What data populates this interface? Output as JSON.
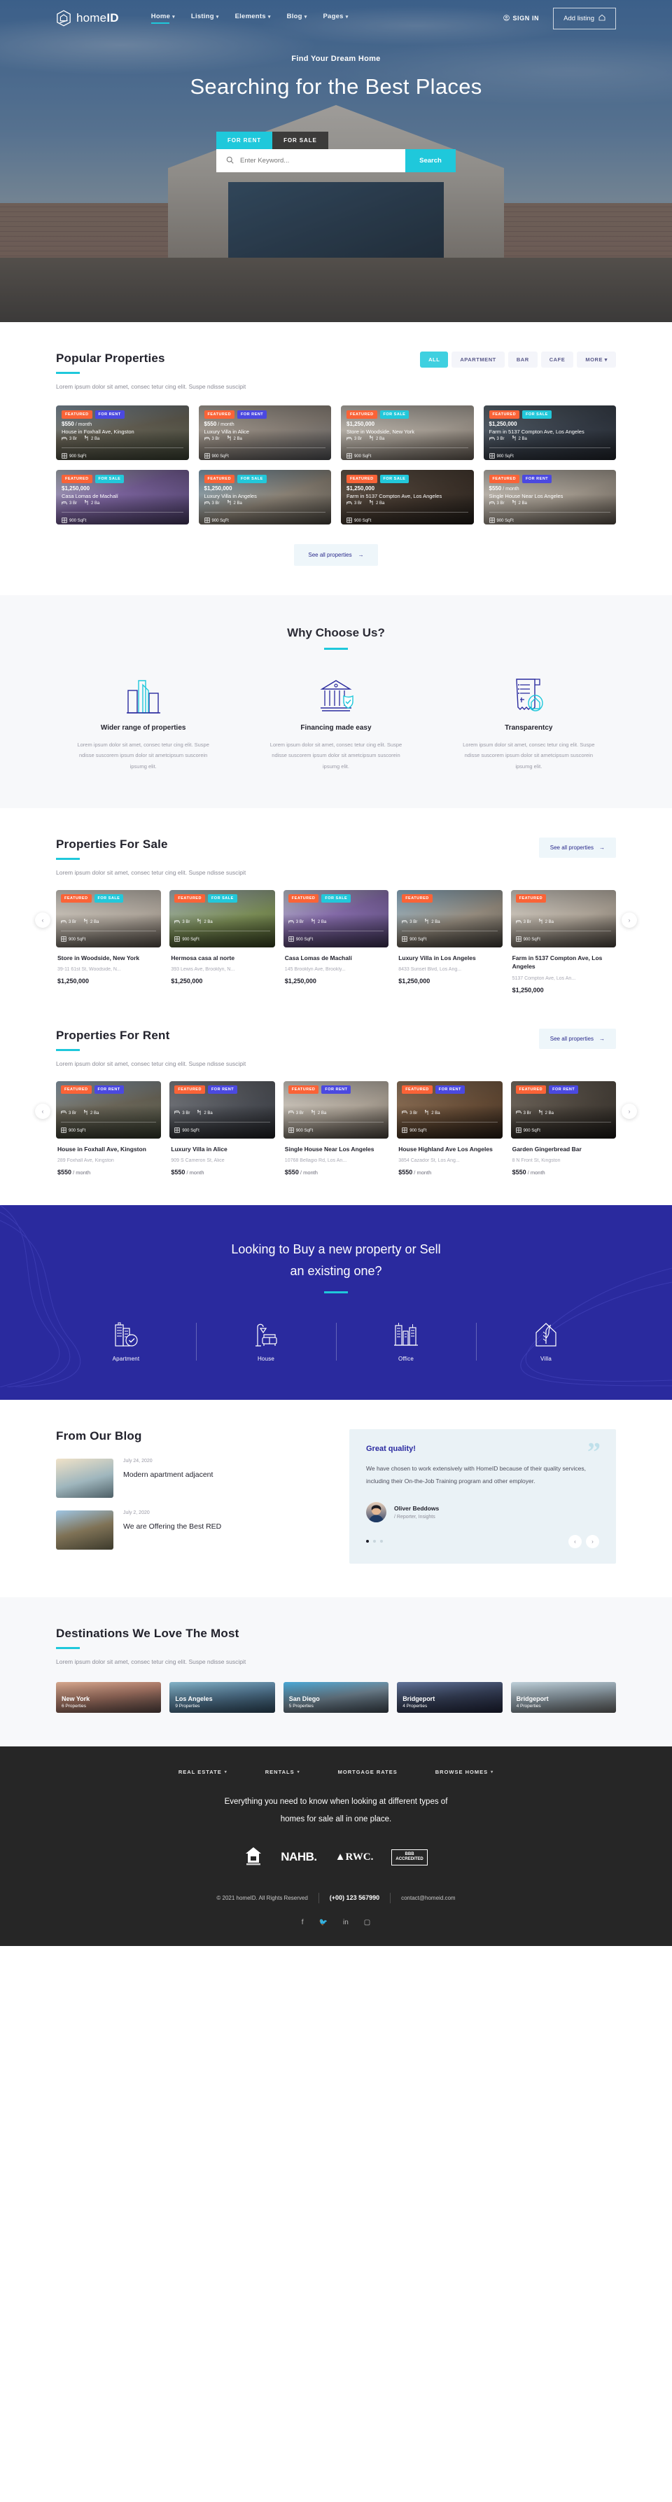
{
  "brand": {
    "name_light": "home",
    "name_bold": "ID"
  },
  "nav": {
    "links": [
      {
        "label": "Home",
        "caret": "⌄"
      },
      {
        "label": "Listing",
        "caret": "⌄"
      },
      {
        "label": "Elements",
        "caret": "⌄"
      },
      {
        "label": "Blog",
        "caret": "⌄"
      },
      {
        "label": "Pages",
        "caret": "⌄"
      }
    ],
    "signin": "SIGN IN",
    "add_listing": "Add listing"
  },
  "hero": {
    "kicker": "Find Your Dream Home",
    "title": "Searching for the Best Places",
    "tab_rent": "FOR RENT",
    "tab_sale": "FOR SALE",
    "search_placeholder": "Enter Keyword...",
    "search_button": "Search"
  },
  "popular": {
    "title": "Popular Properties",
    "subtitle": "Lorem ipsum dolor sit amet, consec tetur cing elit. Suspe ndisse suscipit",
    "filters": [
      "ALL",
      "APARTMENT",
      "BAR",
      "CAFE",
      "MORE ▾"
    ],
    "active_filter": "ALL",
    "see_all": "See all properties",
    "cards": [
      {
        "badges": [
          "FEATURED",
          "FOR RENT"
        ],
        "price": "$550",
        "per": " / month",
        "name": "House in Foxhall Ave, Kingston",
        "beds": "3 Br",
        "baths": "2 Ba",
        "area": "900 SqFt",
        "img": "house-victorian"
      },
      {
        "badges": [
          "FEATURED",
          "FOR RENT"
        ],
        "price": "$550",
        "per": " / month",
        "name": "Luxury Villa in Alice",
        "beds": "3 Br",
        "baths": "2 Ba",
        "area": "900 SqFt",
        "img": "living-room"
      },
      {
        "badges": [
          "FEATURED",
          "FOR SALE"
        ],
        "price": "$1,250,000",
        "per": "",
        "name": "Store in Woodside, New York",
        "beds": "3 Br",
        "baths": "2 Ba",
        "area": "900 SqFt",
        "img": "interior-white"
      },
      {
        "badges": [
          "FEATURED",
          "FOR SALE"
        ],
        "price": "$1,250,000",
        "per": "",
        "name": "Farm in 5137 Compton Ave, Los Angeles",
        "beds": "3 Br",
        "baths": "2 Ba",
        "area": "900 SqFt",
        "img": "modern-dark"
      },
      {
        "badges": [
          "FEATURED",
          "FOR SALE"
        ],
        "price": "$1,250,000",
        "per": "",
        "name": "Casa Lomas de Machalí",
        "beds": "3 Br",
        "baths": "2 Ba",
        "area": "900 SqFt",
        "img": "purple-stairs"
      },
      {
        "badges": [
          "FEATURED",
          "FOR SALE"
        ],
        "price": "$1,250,000",
        "per": "",
        "name": "Luxury Villa in Angeles",
        "beds": "3 Br",
        "baths": "2 Ba",
        "area": "900 SqFt",
        "img": "villa-modern"
      },
      {
        "badges": [
          "FEATURED",
          "FOR SALE"
        ],
        "price": "$1,250,000",
        "per": "",
        "name": "Farm in 5137 Compton Ave, Los Angeles",
        "beds": "3 Br",
        "baths": "2 Ba",
        "area": "900 SqFt",
        "img": "dining-dark"
      },
      {
        "badges": [
          "FEATURED",
          "FOR RENT"
        ],
        "price": "$550",
        "per": " / month",
        "name": "Single House Near Los Angeles",
        "beds": "3 Br",
        "baths": "2 Ba",
        "area": "900 SqFt",
        "img": "bright-room"
      }
    ]
  },
  "why": {
    "title": "Why Choose Us?",
    "columns": [
      {
        "icon": "buildings-icon",
        "title": "Wider range of properties",
        "text": "Lorem ipsum dolor sit amet, consec tetur cing elit. Suspe ndisse suscorem ipsum dolor sit ametcipsum suscorein ipsumg elit."
      },
      {
        "icon": "bank-shield-icon",
        "title": "Financing made easy",
        "text": "Lorem ipsum dolor sit amet, consec tetur cing elit. Suspe ndisse suscorem ipsum dolor sit ametcipsum suscorein ipsumg elit."
      },
      {
        "icon": "receipt-house-icon",
        "title": "Transparentcy",
        "text": "Lorem ipsum dolor sit amet, consec tetur cing elit. Suspe ndisse suscorem ipsum dolor sit ametcipsum suscorein ipsumg elit."
      }
    ]
  },
  "for_sale": {
    "title": "Properties For Sale",
    "subtitle": "Lorem ipsum dolor sit amet, consec tetur cing elit. Suspe ndisse suscipit",
    "see_all": "See all properties",
    "cards": [
      {
        "badges": [
          "FEATURED",
          "FOR SALE"
        ],
        "title": "Store in Woodside, New York",
        "address": "39-11 61st St, Woodside, N...",
        "price": "$1,250,000",
        "per": "",
        "beds": "3 Br",
        "baths": "2 Ba",
        "area": "900 SqFt",
        "img": "interior-white"
      },
      {
        "badges": [
          "FEATURED",
          "FOR SALE"
        ],
        "title": "Hermosa casa al norte",
        "address": "393 Lewis Ave, Brooklyn, N...",
        "price": "$1,250,000",
        "per": "",
        "beds": "3 Br",
        "baths": "2 Ba",
        "area": "900 SqFt",
        "img": "house-green"
      },
      {
        "badges": [
          "FEATURED",
          "FOR SALE"
        ],
        "title": "Casa Lomas de Machalí",
        "address": "145 Brooklyn Ave, Brookly...",
        "price": "$1,250,000",
        "per": "",
        "beds": "3 Br",
        "baths": "2 Ba",
        "area": "900 SqFt",
        "img": "purple-stairs"
      },
      {
        "badges": [
          "FEATURED"
        ],
        "title": "Luxury Villa in Los Angeles",
        "address": "8433 Sunset Blvd, Los Ang...",
        "price": "$1,250,000",
        "per": "",
        "beds": "3 Br",
        "baths": "2 Ba",
        "area": "900 SqFt",
        "img": "villa-modern"
      },
      {
        "badges": [
          "FEATURED"
        ],
        "title": "Farm in 5137 Compton Ave, Los Angeles",
        "address": "5137 Compton Ave, Los An...",
        "price": "$1,250,000",
        "per": "",
        "beds": "3 Br",
        "baths": "2 Ba",
        "area": "900 SqFt",
        "img": "bright-room"
      }
    ]
  },
  "for_rent": {
    "title": "Properties For Rent",
    "subtitle": "Lorem ipsum dolor sit amet, consec tetur cing elit. Suspe ndisse suscipit",
    "see_all": "See all properties",
    "cards": [
      {
        "badges": [
          "FEATURED",
          "FOR RENT"
        ],
        "title": "House in Foxhall Ave, Kingston",
        "address": "289 Foxhall Ave, Kingston",
        "price": "$550",
        "per": " / month",
        "beds": "3 Br",
        "baths": "2 Ba",
        "area": "900 SqFt",
        "img": "house-victorian"
      },
      {
        "badges": [
          "FEATURED",
          "FOR RENT"
        ],
        "title": "Luxury Villa in Alice",
        "address": "909 S Cameron St, Alice",
        "price": "$550",
        "per": " / month",
        "beds": "3 Br",
        "baths": "2 Ba",
        "area": "900 SqFt",
        "img": "patio-dark"
      },
      {
        "badges": [
          "FEATURED",
          "FOR RENT"
        ],
        "title": "Single House Near Los Angeles",
        "address": "10768 Bellagio Rd, Los An...",
        "price": "$550",
        "per": " / month",
        "beds": "3 Br",
        "baths": "2 Ba",
        "area": "900 SqFt",
        "img": "bright-room"
      },
      {
        "badges": [
          "FEATURED",
          "FOR RENT"
        ],
        "title": "House Highland Ave Los Angeles",
        "address": "3854 Cazador St, Los Ang...",
        "price": "$550",
        "per": " / month",
        "beds": "3 Br",
        "baths": "2 Ba",
        "area": "900 SqFt",
        "img": "kitchen-warm"
      },
      {
        "badges": [
          "FEATURED",
          "FOR RENT"
        ],
        "title": "Garden Gingerbread Bar",
        "address": "8 N Front St, Kingston",
        "price": "$550",
        "per": " / month",
        "beds": "3 Br",
        "baths": "2 Ba",
        "area": "900 SqFt",
        "img": "lounge-dark"
      }
    ]
  },
  "cta": {
    "line1": "Looking to Buy a new property or Sell",
    "line2": "an existing one?",
    "items": [
      {
        "icon": "apartment-check-icon",
        "label": "Apartment"
      },
      {
        "icon": "sofa-lamp-icon",
        "label": "House"
      },
      {
        "icon": "office-towers-icon",
        "label": "Office"
      },
      {
        "icon": "villa-leaf-icon",
        "label": "Villa"
      }
    ]
  },
  "blog": {
    "title": "From Our Blog",
    "posts": [
      {
        "date": "July 24, 2020",
        "title": "Modern apartment adjacent",
        "img": "seaside-terrace"
      },
      {
        "date": "July 2, 2020",
        "title": "We are Offering the Best RED",
        "img": "cottage-evening"
      }
    ]
  },
  "testimonial": {
    "heading": "Great quality!",
    "body": "We have chosen to work extensively with HomeID because of their quality services, including their On-the-Job Training program and other employer.",
    "name": "Oliver Beddows",
    "role": "/ Reporter, Insights",
    "dots": 3,
    "active_dot": 0
  },
  "destinations": {
    "title": "Destinations We Love The Most",
    "subtitle": "Lorem ipsum dolor sit amet, consec tetur cing elit. Suspe ndisse suscipit",
    "cards": [
      {
        "name": "New York",
        "count": "6 Properties",
        "img": "nyc-sunset"
      },
      {
        "name": "Los Angeles",
        "count": "9 Properties",
        "img": "la-coast"
      },
      {
        "name": "San Diego",
        "count": "5 Properties",
        "img": "sd-skyline"
      },
      {
        "name": "Bridgeport",
        "count": "4 Properties",
        "img": "bridgeport-night"
      },
      {
        "name": "Bridgeport",
        "count": "4 Properties",
        "img": "bridgeport-day"
      }
    ]
  },
  "footer": {
    "nav": [
      {
        "label": "REAL ESTATE",
        "caret": "⌄"
      },
      {
        "label": "RENTALS",
        "caret": "⌄"
      },
      {
        "label": "MORTGAGE RATES",
        "caret": ""
      },
      {
        "label": "BROWSE HOMES",
        "caret": "⌄"
      }
    ],
    "tagline_1": "Everything you need to know when looking at different types of",
    "tagline_2": "homes for sale all in one place.",
    "logos": [
      "equal-housing-icon",
      "NAHB.",
      "RWC",
      "BBB ACCREDITED BUSINESS"
    ],
    "copyright": "© 2021 homeID. All Rights Reserved",
    "phone": "(+00) 123 567990",
    "email": "contact@homeid.com",
    "social": [
      "facebook-icon",
      "twitter-icon",
      "linkedin-icon",
      "instagram-icon"
    ]
  },
  "colors": {
    "accent": "#1fc8db",
    "primary": "#2a2a9e",
    "featured": "#fa6337",
    "rent": "#4b49e0",
    "sale": "#22c8da"
  }
}
